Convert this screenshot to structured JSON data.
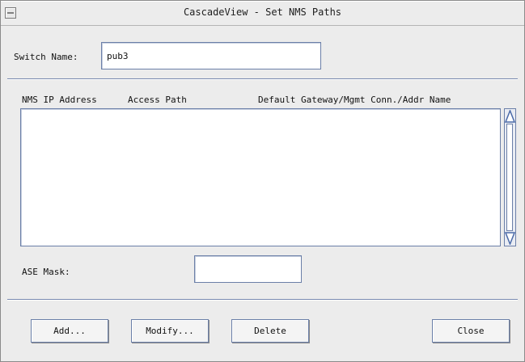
{
  "window": {
    "title": "CascadeView - Set NMS Paths"
  },
  "form": {
    "switch_name_label": "Switch Name:",
    "switch_name_value": "pub3",
    "ase_mask_label": "ASE Mask:",
    "ase_mask_value": ""
  },
  "table": {
    "columns": [
      "NMS IP Address",
      "Access Path",
      "Default Gateway/Mgmt Conn./Addr Name"
    ],
    "rows": []
  },
  "buttons": {
    "add": "Add...",
    "modify": "Modify...",
    "delete": "Delete",
    "close": "Close"
  },
  "icons": {
    "window_menu": "window-menu-icon",
    "scroll_up": "scroll-up-arrow-icon",
    "scroll_down": "scroll-down-arrow-icon"
  },
  "colors": {
    "window_bg": "#ececec",
    "field_border": "#6b7fa8",
    "scroll_arrow": "#4a6aa8"
  }
}
